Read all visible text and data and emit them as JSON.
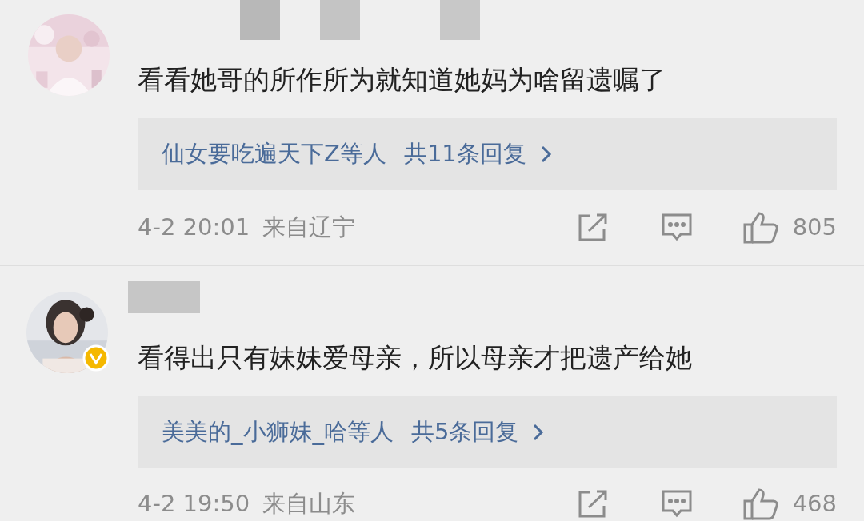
{
  "comments": [
    {
      "verified": false,
      "text": "看看她哥的所作所为就知道她妈为啥留遗嘱了",
      "reply_preview": {
        "names": "仙女要吃遍天下Z等人",
        "count": "共11条回复"
      },
      "time": "4-2 20:01",
      "location": "来自辽宁",
      "likes": "805"
    },
    {
      "verified": true,
      "text": "看得出只有妹妹爱母亲，所以母亲才把遗产给她",
      "reply_preview": {
        "names": "美美的_小狮妹_哈等人",
        "count": "共5条回复"
      },
      "time": "4-2 19:50",
      "location": "来自山东",
      "likes": "468"
    }
  ]
}
